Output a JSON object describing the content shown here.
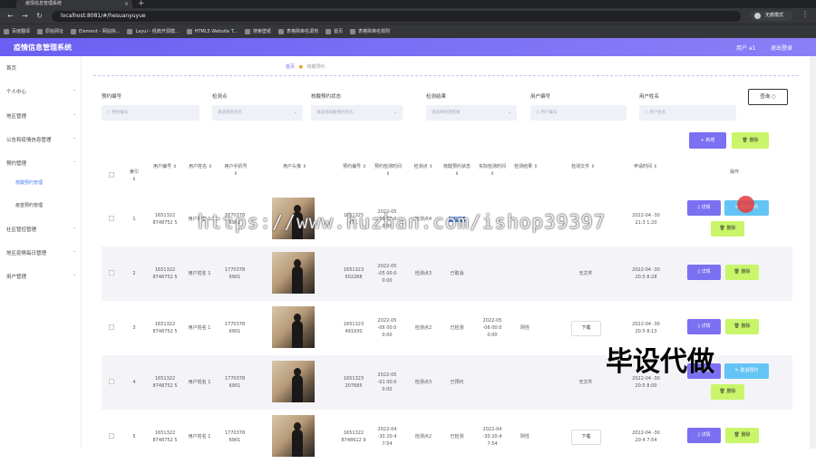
{
  "browser": {
    "tab_title": "疫情信息管理系统",
    "url": "localhost:8081/#/hesuanyuyue",
    "profile_name": "无痕模式",
    "bookmarks": [
      "百度翻译",
      "原始网址",
      "Element - 网站快...",
      "Layui - 经典开源模...",
      "HTML5 Website T...",
      "搜索壁纸",
      "表格购审名调剂",
      "首页",
      "表格购审名规则"
    ]
  },
  "header": {
    "title": "疫情信息管理系统",
    "user": "用户 a1",
    "logout": "退出登录"
  },
  "sidebar": {
    "items": [
      {
        "label": "首页",
        "sub": false,
        "arrow": false
      },
      {
        "label": "个人中心",
        "sub": false,
        "arrow": true
      },
      {
        "label": "地区管理",
        "sub": false,
        "arrow": true
      },
      {
        "label": "公告和疫情信息管理",
        "sub": false,
        "arrow": true
      },
      {
        "label": "预约管理",
        "sub": false,
        "arrow": true
      },
      {
        "label": "核酸预约管理",
        "sub": true,
        "arrow": false,
        "active": true
      },
      {
        "label": "疫苗预约管理",
        "sub": true,
        "arrow": false
      },
      {
        "label": "社区管控管理",
        "sub": false,
        "arrow": true
      },
      {
        "label": "地区疫情每日管理",
        "sub": false,
        "arrow": true
      },
      {
        "label": "用户管理",
        "sub": false,
        "arrow": true
      }
    ]
  },
  "breadcrumb": {
    "home": "首页",
    "current": "核酸预约"
  },
  "filters": [
    {
      "label": "预约编号",
      "placeholder": "预约编号",
      "select": false
    },
    {
      "label": "检测点",
      "placeholder": "请选择检测点",
      "select": true
    },
    {
      "label": "核酸预约状态",
      "placeholder": "请选择核酸预约状态",
      "select": true
    },
    {
      "label": "检测结果",
      "placeholder": "请选择检测结果",
      "select": true
    },
    {
      "label": "用户编号",
      "placeholder": "用户编号",
      "select": false
    },
    {
      "label": "用户姓名",
      "placeholder": "用户姓名",
      "select": false
    }
  ],
  "buttons": {
    "query": "查询",
    "add": "新增",
    "delete": "删除",
    "detail": "详情",
    "cancel": "取消预约",
    "download": "下载"
  },
  "table": {
    "headers": [
      "索引",
      "用户编号",
      "用户姓名",
      "用户手机号",
      "用户头像",
      "预约编号",
      "预约检测时间",
      "检测点",
      "核酸预约状态",
      "实际检测时间",
      "检测结果",
      "检测文件",
      "申请时间",
      "操作"
    ],
    "rows": [
      {
        "index": "1",
        "user_no": "1651322 8748752 5",
        "name": "用户姓名 1",
        "phone": "1770378 6901",
        "appt_no": "1651325 47…",
        "appt_time": "2022-05 -06 00:0 0:00",
        "site": "检测点4",
        "status": "已预约",
        "status_highlight": true,
        "actual": "",
        "result": "",
        "file": "",
        "apply": "2022-04 -30 21:3 1:20",
        "has_cancel": true
      },
      {
        "index": "2",
        "user_no": "1651322 8748752 5",
        "name": "用户姓名 1",
        "phone": "1770378 6901",
        "appt_no": "1651323 502268",
        "appt_time": "2022-05 -05 00:0 0:00",
        "site": "检测点3",
        "status": "已取消",
        "status_highlight": false,
        "actual": "",
        "result": "",
        "file": "无文件",
        "apply": "2022-04 -30 20:5 8:28",
        "has_cancel": false
      },
      {
        "index": "3",
        "user_no": "1651322 8748752 5",
        "name": "用户姓名 1",
        "phone": "1770378 6901",
        "appt_no": "1651323 491930",
        "appt_time": "2022-05 -06 00:0 0:00",
        "site": "检测点2",
        "status": "已检测",
        "status_highlight": false,
        "actual": "2022-05 -06 00:0 0:00",
        "result": "阴性",
        "file": "下载",
        "apply": "2022-04 -30 20:5 8:13",
        "has_cancel": false
      },
      {
        "index": "4",
        "user_no": "1651322 8748752 5",
        "name": "用户姓名 1",
        "phone": "1770378 6901",
        "appt_no": "1651323 207685",
        "appt_time": "2022-05 -01 00:0 0:00",
        "site": "检测点3",
        "status": "已预约",
        "status_highlight": false,
        "actual": "",
        "result": "",
        "file": "无文件",
        "apply": "2022-04 -30 20:5 8:00",
        "has_cancel": true
      },
      {
        "index": "5",
        "user_no": "1651322 8748752 5",
        "name": "用户姓名 1",
        "phone": "1770378 6901",
        "appt_no": "1651322 8748612 9",
        "appt_time": "2022-04 -30 20:4 7:54",
        "site": "检测点2",
        "status": "已检测",
        "status_highlight": false,
        "actual": "2022-04 -30 20:4 7:54",
        "result": "阴性",
        "file": "下载",
        "apply": "2022-04 -30 20:4 7:54",
        "has_cancel": false
      }
    ]
  },
  "overlay": {
    "watermark": "https://www.huzhan.com/ishop39397",
    "promo": "毕设代做"
  }
}
